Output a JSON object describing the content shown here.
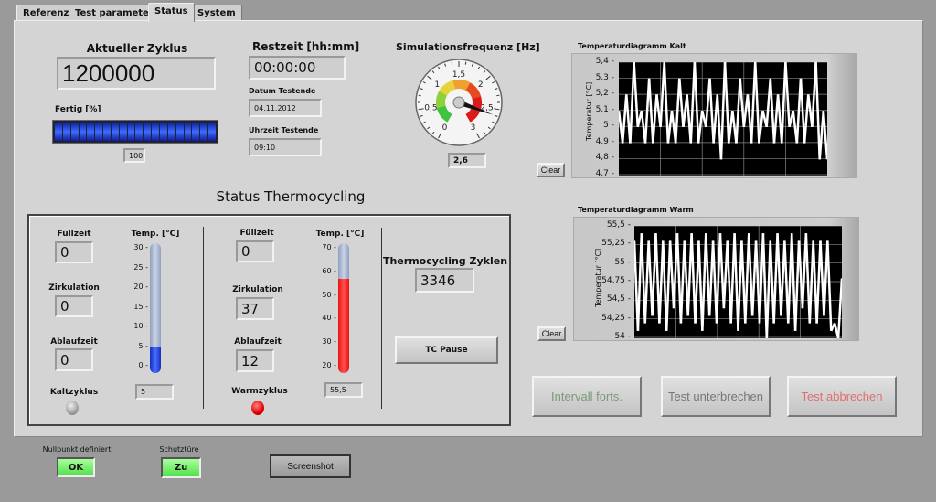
{
  "tabs": [
    {
      "label": "Referenz"
    },
    {
      "label": "Test parameter"
    },
    {
      "label": "Status",
      "active": true
    },
    {
      "label": "System"
    }
  ],
  "cycle": {
    "label": "Aktueller Zyklus",
    "value": "1200000"
  },
  "progress": {
    "label": "Fertig [%]",
    "value": "100",
    "percent": 100,
    "color": "#1a3fd0"
  },
  "remaining": {
    "label": "Restzeit [hh:mm]",
    "value": "00:00:00"
  },
  "end_date": {
    "label": "Datum Testende",
    "value": "04.11.2012"
  },
  "end_time": {
    "label": "Uhrzeit Testende",
    "value": "09:10"
  },
  "gauge": {
    "label": "Simulationsfrequenz [Hz]",
    "value": "2,6",
    "numeric": 2.6,
    "min": 0,
    "max": 3,
    "ticks": [
      "0",
      "0,5",
      "1",
      "1,5",
      "2",
      "2,5",
      "3"
    ]
  },
  "chart_data": [
    {
      "type": "line",
      "title": "Temperaturdiagramm Kalt",
      "ylabel": "Temperatur [°C]",
      "ylim": [
        4.7,
        5.4
      ],
      "yticks": [
        "5,4",
        "5,3",
        "5,2",
        "5,1",
        "5",
        "4,9",
        "4,8",
        "4,7"
      ],
      "grid": true,
      "background": "#000000",
      "line_color": "#ffffff",
      "values": [
        5.1,
        4.9,
        5.2,
        4.9,
        5.4,
        5.0,
        5.1,
        4.9,
        5.3,
        4.9,
        5.2,
        5.0,
        5.4,
        4.9,
        5.1,
        4.9,
        5.3,
        5.0,
        5.2,
        4.9,
        5.4,
        4.9,
        5.1,
        5.0,
        5.3,
        4.9,
        5.2,
        4.8,
        5.4,
        4.9,
        5.1,
        4.9,
        5.3,
        5.0,
        5.2,
        4.9,
        5.4,
        4.9,
        5.1,
        5.0,
        5.3,
        4.9,
        5.2,
        4.9,
        5.4,
        5.0,
        5.1,
        4.9,
        5.3,
        4.9,
        5.2,
        5.0,
        5.4,
        4.8,
        5.1,
        4.8
      ]
    },
    {
      "type": "line",
      "title": "Temperaturdiagramm Warm",
      "ylabel": "Temperatur [°C]",
      "ylim": [
        54,
        55.5
      ],
      "yticks": [
        "55,5",
        "55,25",
        "55",
        "54,75",
        "54,5",
        "54,25",
        "54"
      ],
      "grid": true,
      "background": "#000000",
      "line_color": "#ffffff",
      "values": [
        55.3,
        54.1,
        55.4,
        54.2,
        55.3,
        54.3,
        55.4,
        54.2,
        55.3,
        54.1,
        55.3,
        54.4,
        55.4,
        54.2,
        55.3,
        54.3,
        55.4,
        54.2,
        55.3,
        54.1,
        55.4,
        54.3,
        55.3,
        54.2,
        55.4,
        54.4,
        55.3,
        54.2,
        55.4,
        54.1,
        55.3,
        54.2,
        55.4,
        54.3,
        55.3,
        54.2,
        55.4,
        54.0,
        55.3,
        54.2,
        55.4,
        54.3,
        55.3,
        54.2,
        55.4,
        54.1,
        55.3,
        54.4,
        55.4,
        54.2,
        55.3,
        54.2,
        55.3,
        54.3,
        55.3,
        54.1,
        54.2,
        54.0,
        54.8
      ]
    }
  ],
  "clear_label": "Clear",
  "thermo": {
    "title": "Status Thermocycling",
    "cold": {
      "fill_label": "Füllzeit",
      "fill": "0",
      "circ_label": "Zirkulation",
      "circ": "0",
      "drain_label": "Ablaufzeit",
      "drain": "0",
      "temp_label": "Temp. [°C]",
      "temp": "5",
      "temp_num": 5,
      "scale": [
        "30",
        "25",
        "20",
        "15",
        "10",
        "5",
        "0"
      ],
      "min": 0,
      "max": 30,
      "cycle_label": "Kaltzyklus",
      "led_on": false,
      "color": "#1030c0"
    },
    "warm": {
      "fill_label": "Füllzeit",
      "fill": "0",
      "circ_label": "Zirkulation",
      "circ": "37",
      "drain_label": "Ablaufzeit",
      "drain": "12",
      "temp_label": "Temp. [°C]",
      "temp": "55,5",
      "temp_num": 55.5,
      "scale": [
        "70",
        "60",
        "50",
        "40",
        "30",
        "20"
      ],
      "min": 20,
      "max": 70,
      "cycle_label": "Warmzyklus",
      "led_on": true,
      "color": "#ee1111"
    },
    "cycles_label": "Thermocycling Zyklen",
    "cycles": "3346",
    "pause_label": "TC Pause"
  },
  "actions": {
    "continue": "Intervall forts.",
    "interrupt": "Test unterbrechen",
    "abort": "Test abbrechen"
  },
  "footer": {
    "zero_label": "Nullpunkt definiert",
    "zero_value": "OK",
    "door_label": "Schutztüre",
    "door_value": "Zu",
    "screenshot": "Screenshot"
  }
}
